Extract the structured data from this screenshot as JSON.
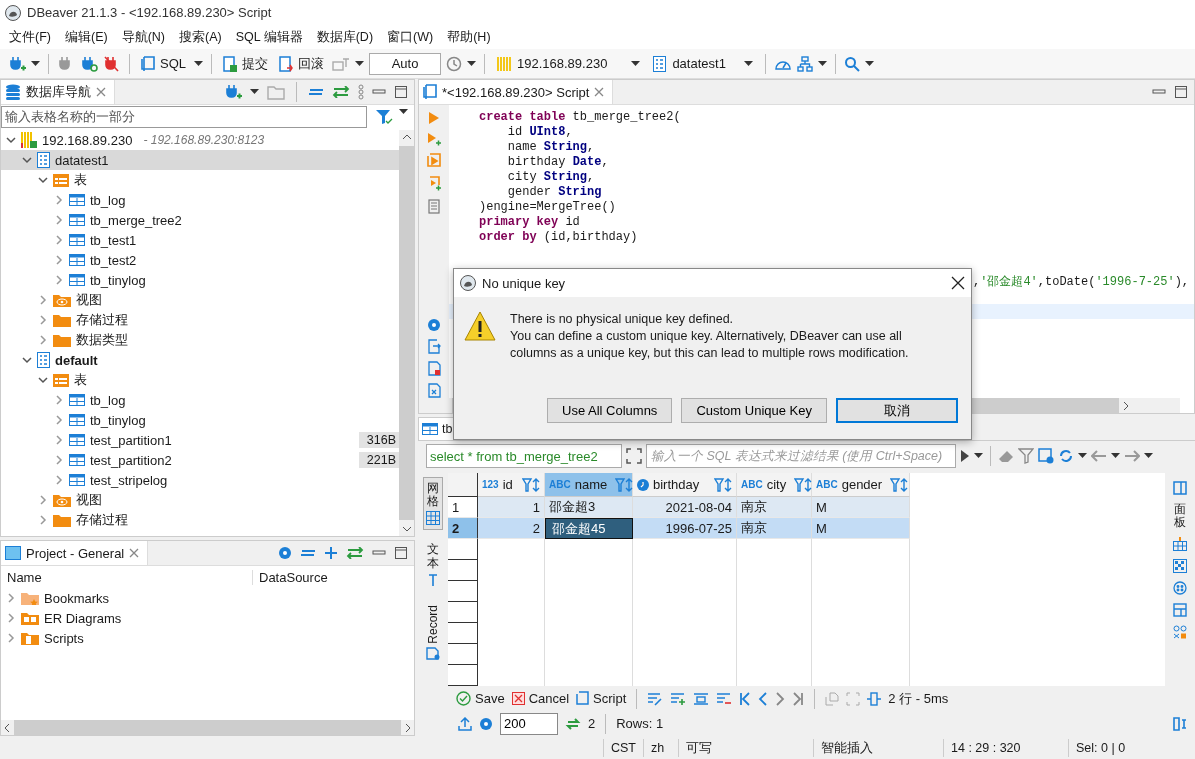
{
  "window": {
    "title": "DBeaver 21.1.3 - <192.168.89.230> Script"
  },
  "menu": [
    "文件(F)",
    "编辑(E)",
    "导航(N)",
    "搜索(A)",
    "SQL 编辑器",
    "数据库(D)",
    "窗口(W)",
    "帮助(H)"
  ],
  "toolbar": {
    "sql": "SQL",
    "commit": "提交",
    "rollback": "回滚",
    "mode": "Auto",
    "connection": "192.168.89.230",
    "database": "datatest1"
  },
  "navigator": {
    "title": "数据库导航",
    "filter_placeholder": "输入表格名称的一部分",
    "tree": [
      {
        "label": "192.168.89.230",
        "detail": "- 192.168.89.230:8123",
        "kind": "connection",
        "expanded": true,
        "selected": false,
        "active": false,
        "children": [
          {
            "label": "datatest1",
            "kind": "database",
            "expanded": true,
            "selected": true,
            "active": false,
            "children": [
              {
                "label": "表",
                "kind": "tables",
                "expanded": true,
                "selected": false,
                "active": false,
                "children": [
                  {
                    "label": "tb_log",
                    "kind": "table",
                    "expanded": false,
                    "selected": false,
                    "active": false
                  },
                  {
                    "label": "tb_merge_tree2",
                    "kind": "table",
                    "expanded": false,
                    "selected": false,
                    "active": false
                  },
                  {
                    "label": "tb_test1",
                    "kind": "table",
                    "expanded": false,
                    "selected": false,
                    "active": false
                  },
                  {
                    "label": "tb_test2",
                    "kind": "table",
                    "expanded": false,
                    "selected": false,
                    "active": false
                  },
                  {
                    "label": "tb_tinylog",
                    "kind": "table",
                    "expanded": false,
                    "selected": false,
                    "active": false
                  }
                ]
              },
              {
                "label": "视图",
                "kind": "views",
                "expanded": false,
                "selected": false,
                "active": false
              },
              {
                "label": "存储过程",
                "kind": "folder",
                "expanded": false,
                "selected": false,
                "active": false
              },
              {
                "label": "数据类型",
                "kind": "folder",
                "expanded": false,
                "selected": false,
                "active": false
              }
            ]
          },
          {
            "label": "default",
            "kind": "database",
            "expanded": true,
            "selected": false,
            "active": true,
            "children": [
              {
                "label": "表",
                "kind": "tables",
                "expanded": true,
                "selected": false,
                "active": false,
                "children": [
                  {
                    "label": "tb_log",
                    "kind": "table",
                    "expanded": false,
                    "selected": false,
                    "active": false
                  },
                  {
                    "label": "tb_tinylog",
                    "kind": "table",
                    "expanded": false,
                    "selected": false,
                    "active": false
                  },
                  {
                    "label": "test_partition1",
                    "size": "316B",
                    "kind": "table",
                    "expanded": false,
                    "selected": false,
                    "active": false
                  },
                  {
                    "label": "test_partition2",
                    "size": "221B",
                    "kind": "table",
                    "expanded": false,
                    "selected": false,
                    "active": false
                  },
                  {
                    "label": "test_stripelog",
                    "kind": "table",
                    "expanded": false,
                    "selected": false,
                    "active": false
                  }
                ]
              },
              {
                "label": "视图",
                "kind": "views",
                "expanded": false,
                "selected": false,
                "active": false
              },
              {
                "label": "存储过程",
                "kind": "folder",
                "expanded": false,
                "selected": false,
                "active": false
              }
            ]
          }
        ]
      }
    ]
  },
  "project": {
    "title": "Project - General",
    "columns": [
      "Name",
      "DataSource"
    ],
    "items": [
      {
        "label": "Bookmarks",
        "kind": "bookmarks",
        "expanded": false
      },
      {
        "label": "ER Diagrams",
        "kind": "diagrams",
        "expanded": false
      },
      {
        "label": "Scripts",
        "kind": "scripts",
        "expanded": false
      }
    ]
  },
  "editor": {
    "tab": "*<192.168.89.230> Script",
    "lines": [
      {
        "current": false,
        "kind": "normal",
        "segments": [
          {
            "text": "create table",
            "kind": "kw"
          },
          {
            "text": " tb_merge_tree2(",
            "kind": "plain"
          }
        ]
      },
      {
        "current": false,
        "kind": "normal",
        "segments": [
          {
            "text": "    id ",
            "kind": "plain"
          },
          {
            "text": "UInt8",
            "kind": "type"
          },
          {
            "text": ",",
            "kind": "plain"
          }
        ]
      },
      {
        "current": false,
        "kind": "normal",
        "segments": [
          {
            "text": "    name ",
            "kind": "plain"
          },
          {
            "text": "String",
            "kind": "type"
          },
          {
            "text": ",",
            "kind": "plain"
          }
        ]
      },
      {
        "current": false,
        "kind": "normal",
        "segments": [
          {
            "text": "    birthday ",
            "kind": "plain"
          },
          {
            "text": "Date",
            "kind": "type"
          },
          {
            "text": ",",
            "kind": "plain"
          }
        ]
      },
      {
        "current": false,
        "kind": "normal",
        "segments": [
          {
            "text": "    city ",
            "kind": "plain"
          },
          {
            "text": "String",
            "kind": "type"
          },
          {
            "text": ",",
            "kind": "plain"
          }
        ]
      },
      {
        "current": false,
        "kind": "normal",
        "segments": [
          {
            "text": "    gender ",
            "kind": "plain"
          },
          {
            "text": "String",
            "kind": "type"
          }
        ]
      },
      {
        "current": false,
        "kind": "normal",
        "segments": [
          {
            "text": ")engine=MergeTree()",
            "kind": "plain"
          }
        ]
      },
      {
        "current": false,
        "kind": "normal",
        "segments": [
          {
            "text": "primary key",
            "kind": "kw"
          },
          {
            "text": " id",
            "kind": "plain"
          }
        ]
      },
      {
        "current": false,
        "kind": "normal",
        "segments": [
          {
            "text": "order by",
            "kind": "kw"
          },
          {
            "text": " (id,birthday)",
            "kind": "plain"
          }
        ]
      },
      {
        "current": false,
        "kind": "normal"
      },
      {
        "current": false,
        "kind": "normal"
      },
      {
        "current": false,
        "kind": "covered",
        "segments": [
          {
            "text": ",",
            "kind": "plain"
          },
          {
            "text": "'邵金超4'",
            "kind": "str"
          },
          {
            "text": ",toDate(",
            "kind": "plain"
          },
          {
            "text": "'1996-7-25'",
            "kind": "str"
          },
          {
            "text": "),",
            "kind": "plain"
          }
        ]
      },
      {
        "current": false,
        "kind": "normal"
      },
      {
        "current": true,
        "kind": "normal"
      }
    ]
  },
  "dialog": {
    "title": "No unique key",
    "heading": "There is no physical unique key defined.",
    "message": "You can define a custom unique key. Alternatively, DBeaver can use all columns as a unique key, but this can lead to multiple rows modification.",
    "buttons": [
      {
        "label": "Use All Columns",
        "default": false
      },
      {
        "label": "Custom Unique Key",
        "default": false
      },
      {
        "label": "取消",
        "default": true
      }
    ]
  },
  "results": {
    "tab": "tb",
    "query": "select * from tb_merge_tree2",
    "filter_placeholder": "输入一个 SQL 表达式来过滤结果 (使用 Ctrl+Space)",
    "views": [
      {
        "label": "网格",
        "kind": "grid",
        "selected": true
      },
      {
        "label": "文本",
        "kind": "text",
        "selected": false
      },
      {
        "label": "Record",
        "kind": "record",
        "selected": false
      }
    ],
    "panels_label": "面板",
    "columns": [
      {
        "label": "id",
        "kind": "number",
        "prefix": "123",
        "selected": false
      },
      {
        "label": "name",
        "kind": "text",
        "prefix": "ABC",
        "selected": true
      },
      {
        "label": "birthday",
        "kind": "date",
        "selected": false
      },
      {
        "label": "city",
        "kind": "text",
        "prefix": "ABC",
        "selected": false
      },
      {
        "label": "gender",
        "kind": "text",
        "prefix": "ABC",
        "selected": false
      }
    ],
    "rows": [
      {
        "header": "1",
        "selected": false,
        "cells": [
          {
            "v": "1",
            "focused": false
          },
          {
            "v": "邵金超3",
            "focused": false
          },
          {
            "v": "2021-08-04",
            "focused": false
          },
          {
            "v": "南京",
            "focused": false
          },
          {
            "v": "M",
            "focused": false
          }
        ]
      },
      {
        "header": "2",
        "selected": true,
        "cells": [
          {
            "v": "2",
            "focused": false
          },
          {
            "v": "邵金超45",
            "focused": true
          },
          {
            "v": "1996-07-25",
            "focused": false
          },
          {
            "v": "南京",
            "focused": false
          },
          {
            "v": "M",
            "focused": false
          }
        ]
      }
    ],
    "save": "Save",
    "cancel": "Cancel",
    "script": "Script",
    "stats": "2 行 - 5ms",
    "fetch_size": "200",
    "refresh_count": "2",
    "row_count": "Rows: 1"
  },
  "status_bar": [
    "CST",
    "zh",
    "可写",
    "智能插入",
    "14 : 29 : 320",
    "Sel: 0 | 0"
  ]
}
